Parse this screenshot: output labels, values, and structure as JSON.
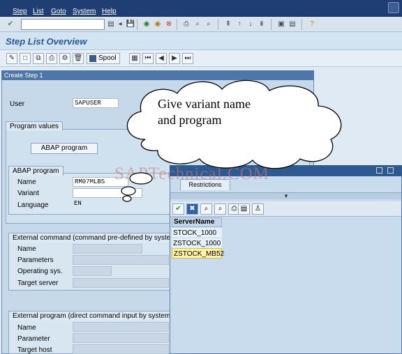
{
  "menu": [
    "Step",
    "List",
    "Goto",
    "System",
    "Help"
  ],
  "title": "Step List Overview",
  "app_toolbar": {
    "spool_label": "Spool"
  },
  "dialog": {
    "title": "Create Step  1",
    "user_label": "User",
    "user_value": "SAPUSER",
    "program_values_label": "Program values",
    "abap_program_button": "ABAP program",
    "abap_group_label": "ABAP program",
    "name_label": "Name",
    "name_value": "RM07MLBS",
    "variant_label": "Variant",
    "language_label": "Language",
    "language_value": "EN",
    "ext_cmd_label": "External command (command pre-defined by system",
    "ext_cmd_fields": [
      "Name",
      "Parameters",
      "Operating sys.",
      "Target server"
    ],
    "ext_prog_label": "External program (direct command input by system ac",
    "ext_prog_fields": [
      "Name",
      "Parameter",
      "Target host"
    ]
  },
  "callout": {
    "line1": "Give variant name",
    "line2": "and program"
  },
  "watermark": "SAPTechnical.COM",
  "popup": {
    "tab_restrictions": "Restrictions",
    "column_header": "ServerName",
    "rows": [
      "STOCK_1000",
      "ZSTOCK_1000",
      "ZSTOCK_MB52"
    ],
    "selected_row": "ZSTOCK_MB52"
  },
  "colors": {
    "menubar": "#1f3e73",
    "title_text": "#2a5898",
    "selected_row": "#fff3a6"
  }
}
